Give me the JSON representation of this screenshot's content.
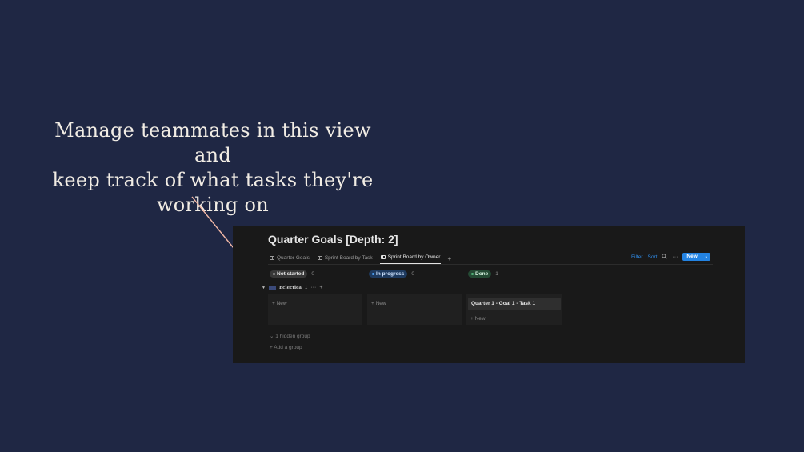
{
  "callout": {
    "line1": "Manage teammates in this view and",
    "line2": "keep track of what tasks they're",
    "line3": "working on"
  },
  "app": {
    "title": "Quarter Goals [Depth: 2]",
    "tabs": [
      {
        "label": "Quarter Goals",
        "active": false
      },
      {
        "label": "Sprint Board by Task",
        "active": false
      },
      {
        "label": "Sprint Board by Owner",
        "active": true
      }
    ],
    "add_tab": "+",
    "toolbar": {
      "filter": "Filter",
      "sort": "Sort",
      "search_icon": "search-icon",
      "more": "···",
      "new": "New",
      "new_chevron": "⌄"
    },
    "columns": [
      {
        "status": "Not started",
        "count": "0",
        "color": "#9b9b9b"
      },
      {
        "status": "In progress",
        "count": "0",
        "color": "#4c9ef0"
      },
      {
        "status": "Done",
        "count": "1",
        "color": "#52b277"
      }
    ],
    "group": {
      "caret": "▼",
      "owner": "Eclectica",
      "count": "1",
      "more": "···",
      "add": "+"
    },
    "new_label": "+ New",
    "cards": [
      {
        "column": "Done",
        "title": "Quarter 1 - Goal 1 - Task 1"
      }
    ],
    "hidden_group": "⌄  1 hidden group",
    "add_group": "+  Add a group"
  }
}
